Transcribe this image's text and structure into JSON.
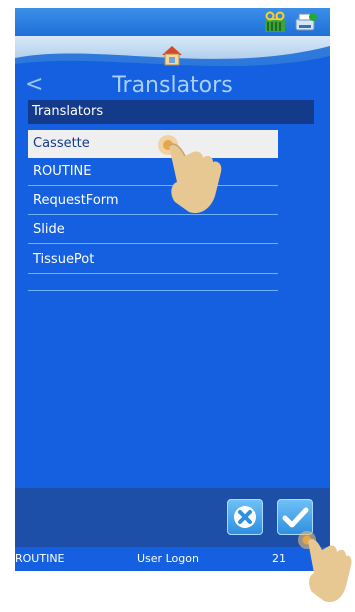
{
  "navigation": {
    "title": "Translators",
    "back_glyph": "<"
  },
  "list": {
    "header": "Translators",
    "items": [
      {
        "label": "Cassette",
        "selected": true
      },
      {
        "label": "ROUTINE",
        "selected": false
      },
      {
        "label": "RequestForm",
        "selected": false
      },
      {
        "label": "Slide",
        "selected": false
      },
      {
        "label": "TissuePot",
        "selected": false
      }
    ]
  },
  "footer": {
    "left": "ROUTINE",
    "center": "User Logon",
    "right": "21"
  },
  "icons": {
    "status": [
      "tape-icon",
      "printer-icon"
    ],
    "home": "home-icon",
    "cancel": "cancel-x-icon",
    "ok": "checkmark-icon",
    "pointer": "tap-hand-icon"
  },
  "colors": {
    "background": "#1560e0",
    "header": "#143a8c",
    "selected_row": "#efefef",
    "title": "#a9d0ff"
  }
}
